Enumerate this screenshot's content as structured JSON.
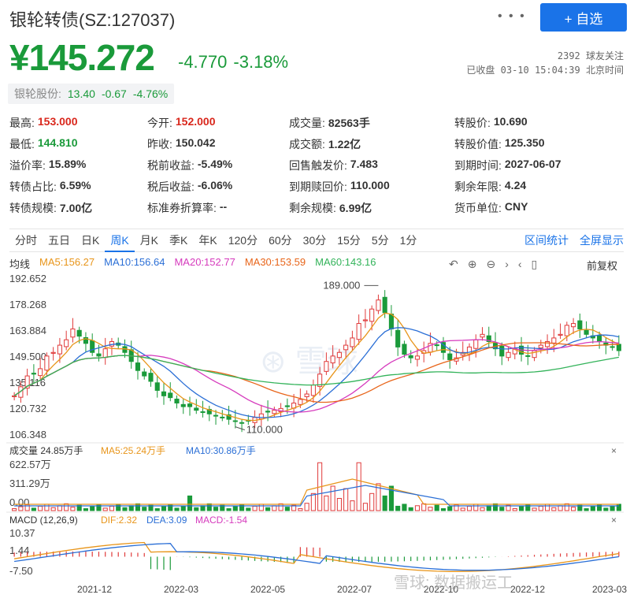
{
  "header": {
    "title": "银轮转债(SZ:127037)",
    "icons": "• • •",
    "add_button": "+ 自选",
    "price": "¥145.272",
    "change": "-4.770",
    "change_pct": "-3.18%",
    "followers": "2392 球友关注",
    "status": "已收盘 03-10 15:04:39 北京时间"
  },
  "stock": {
    "label": "银轮股份:",
    "price": "13.40",
    "change": "-0.67",
    "change_pct": "-4.76%"
  },
  "quote_rows": [
    [
      {
        "k": "最高:",
        "v": "153.000",
        "c": "red"
      },
      {
        "k": "今开:",
        "v": "152.000",
        "c": "red"
      },
      {
        "k": "成交量:",
        "v": "82563手",
        "c": ""
      },
      {
        "k": "转股价:",
        "v": "10.690",
        "c": ""
      }
    ],
    [
      {
        "k": "最低:",
        "v": "144.810",
        "c": "green"
      },
      {
        "k": "昨收:",
        "v": "150.042",
        "c": ""
      },
      {
        "k": "成交额:",
        "v": "1.22亿",
        "c": ""
      },
      {
        "k": "转股价值:",
        "v": "125.350",
        "c": ""
      }
    ],
    [
      {
        "k": "溢价率:",
        "v": "15.89%",
        "c": ""
      },
      {
        "k": "税前收益:",
        "v": "-5.49%",
        "c": ""
      },
      {
        "k": "回售触发价:",
        "v": "7.483",
        "c": ""
      },
      {
        "k": "到期时间:",
        "v": "2027-06-07",
        "c": ""
      }
    ],
    [
      {
        "k": "转债占比:",
        "v": "6.59%",
        "c": ""
      },
      {
        "k": "税后收益:",
        "v": "-6.06%",
        "c": ""
      },
      {
        "k": "到期赎回价:",
        "v": "110.000",
        "c": ""
      },
      {
        "k": "剩余年限:",
        "v": "4.24",
        "c": ""
      }
    ],
    [
      {
        "k": "转债规模:",
        "v": "7.00亿",
        "c": ""
      },
      {
        "k": "标准券折算率:",
        "v": "--",
        "c": ""
      },
      {
        "k": "剩余规模:",
        "v": "6.99亿",
        "c": ""
      },
      {
        "k": "货币单位:",
        "v": "CNY",
        "c": ""
      }
    ]
  ],
  "tabs": [
    "分时",
    "五日",
    "日K",
    "周K",
    "月K",
    "季K",
    "年K",
    "120分",
    "60分",
    "30分",
    "15分",
    "5分",
    "1分"
  ],
  "active_tab": "周K",
  "tab_links": [
    "区间统计",
    "全屏显示"
  ],
  "ma": {
    "label": "均线",
    "items": [
      {
        "text": "MA5:156.27",
        "color": "#e8951a"
      },
      {
        "text": "MA10:156.64",
        "color": "#2b6fd6"
      },
      {
        "text": "MA20:152.77",
        "color": "#d63bbd"
      },
      {
        "text": "MA30:153.59",
        "color": "#e8651a"
      },
      {
        "text": "MA60:143.16",
        "color": "#33b35a"
      }
    ],
    "ctrl_icons": [
      "↶",
      "⊕",
      "⊖",
      "›",
      "‹",
      "▯"
    ],
    "adjust": "前复权"
  },
  "chart_data": {
    "type": "candlestick",
    "y_ticks": [
      "192.652",
      "178.268",
      "163.884",
      "149.500",
      "135.116",
      "120.732",
      "106.348"
    ],
    "ylim": [
      106.348,
      192.652
    ],
    "annot_high": "189.000",
    "annot_low": "110.000",
    "x_ticks": [
      "2021-12",
      "2022-03",
      "2022-05",
      "2022-07",
      "2022-10",
      "2022-12",
      "2023-03"
    ],
    "volume": {
      "title": "成交量 24.85万手",
      "ma5": "MA5:25.24万手",
      "ma10": "MA10:30.86万手",
      "y_ticks": [
        "622.57万",
        "311.29万",
        "0.00"
      ]
    },
    "macd": {
      "title": "MACD (12,26,9)",
      "dif": "DIF:2.32",
      "dea": "DEA:3.09",
      "macd": "MACD:-1.54",
      "y_ticks": [
        "10.37",
        "1.44",
        "-7.50"
      ]
    }
  },
  "watermark": "雪球: 数据搬运工",
  "close_symbol": "×"
}
